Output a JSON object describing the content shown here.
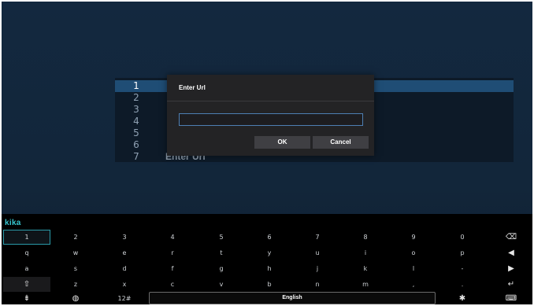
{
  "list": {
    "rows": [
      {
        "num": "1",
        "text": ""
      },
      {
        "num": "2",
        "text": ""
      },
      {
        "num": "3",
        "text": ""
      },
      {
        "num": "4",
        "text": ""
      },
      {
        "num": "5",
        "text": ""
      },
      {
        "num": "6",
        "text": ""
      },
      {
        "num": "7",
        "text": "Enter Url"
      }
    ]
  },
  "dialog": {
    "title": "Enter Url",
    "input_value": "",
    "ok_label": "OK",
    "cancel_label": "Cancel"
  },
  "keyboard": {
    "brand": "kika",
    "row1": [
      "1",
      "2",
      "3",
      "4",
      "5",
      "6",
      "7",
      "8",
      "9",
      "0"
    ],
    "row2": [
      "q",
      "w",
      "e",
      "r",
      "t",
      "y",
      "u",
      "i",
      "o",
      "p"
    ],
    "row3": [
      "a",
      "s",
      "d",
      "f",
      "g",
      "h",
      "j",
      "k",
      "l",
      "-"
    ],
    "row4": [
      "",
      "z",
      "x",
      "c",
      "v",
      "b",
      "n",
      "m",
      ",",
      "."
    ],
    "row5": {
      "numbers_label": "12#",
      "space_label": "English"
    },
    "side_icons": [
      "backspace-icon",
      "arrow-left-icon",
      "arrow-right-icon",
      "enter-icon",
      "keyboard-icon"
    ],
    "side_glyphs": [
      "⌫",
      "◀",
      "▶",
      "↵",
      "⌨"
    ],
    "shift_glyph": "⇧",
    "hide_glyph": "⇟",
    "globe_glyph": "◍",
    "settings_glyph": "✱"
  },
  "colors": {
    "accent": "#37c6d0",
    "selected_row": "#1f4d75",
    "input_border": "#4d7fb3"
  }
}
